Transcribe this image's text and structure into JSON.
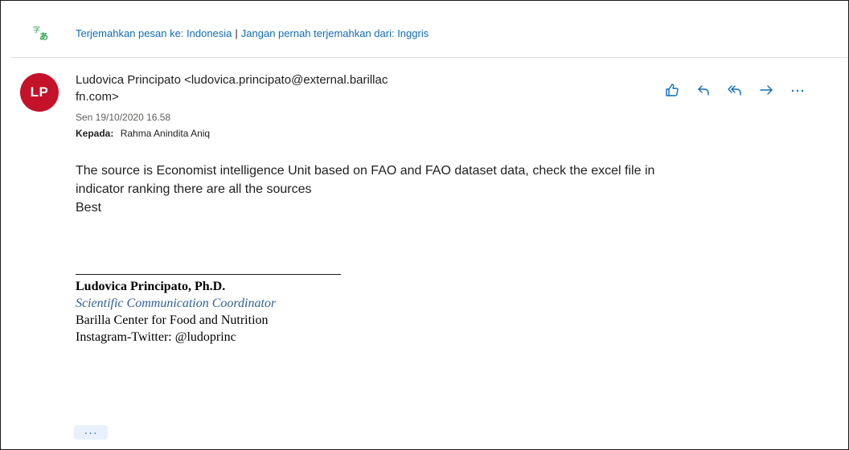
{
  "translation_bar": {
    "icon": "translate-icon",
    "translate_link": "Terjemahkan pesan ke: Indonesia",
    "separator": "|",
    "never_translate_link": "Jangan pernah terjemahkan dari: Inggris"
  },
  "message": {
    "avatar_initials": "LP",
    "sender_line1": "Ludovica Principato <ludovica.principato@external.barillac",
    "sender_line2": "fn.com>",
    "date": "Sen 19/10/2020 16.58",
    "to_label": "Kepada:",
    "to_value": "Rahma Anindita Aniq",
    "body_lines": [
      "The source is Economist intelligence Unit based on FAO and FAO dataset data, check the excel file in",
      "indicator ranking there are all the sources",
      "Best"
    ],
    "signature": {
      "name": "Ludovica Principato, Ph.D.",
      "title": "Scientific Communication Coordinator",
      "org": "Barilla Center for Food and Nutrition",
      "social": "Instagram-Twitter: @ludoprinc"
    },
    "show_more": "···"
  },
  "actions": [
    {
      "icon": "like-icon"
    },
    {
      "icon": "reply-icon"
    },
    {
      "icon": "reply-all-icon"
    },
    {
      "icon": "forward-icon"
    },
    {
      "icon": "more-icon"
    }
  ],
  "colors": {
    "accent": "#0f6cbd",
    "avatar_bg": "#c4122a",
    "signature_title": "#2f5f9a"
  }
}
